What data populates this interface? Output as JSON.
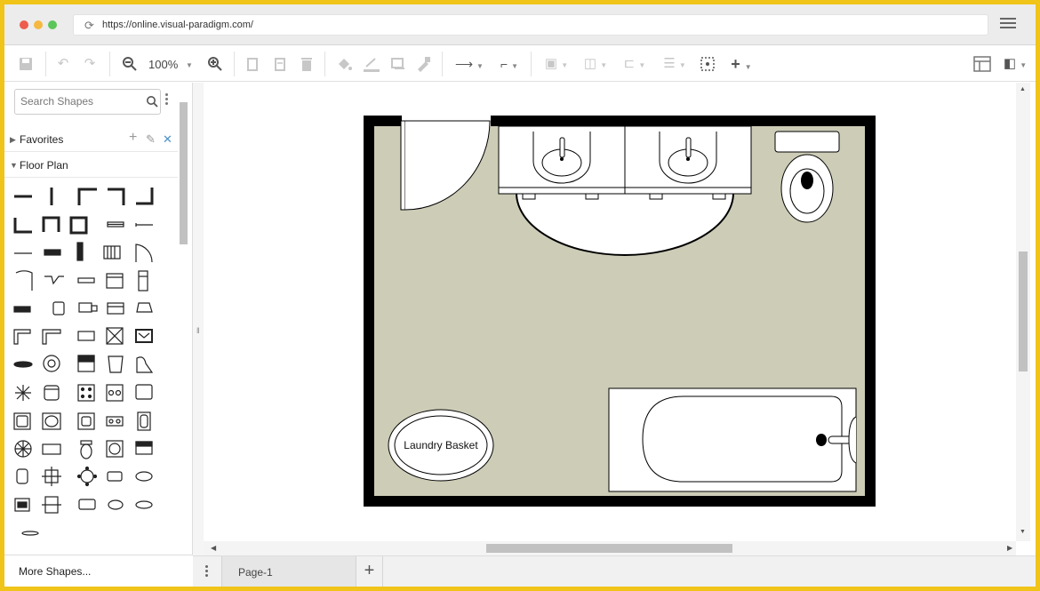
{
  "browser": {
    "url": "https://online.visual-paradigm.com/",
    "dots": [
      "#ee5c4d",
      "#f5b941",
      "#5bc55a"
    ]
  },
  "toolbar": {
    "zoom_value": "100%"
  },
  "sidebar": {
    "search_placeholder": "Search Shapes",
    "sections": [
      {
        "label": "Favorites",
        "expanded": false
      },
      {
        "label": "Floor Plan",
        "expanded": true
      }
    ],
    "more_shapes_label": "More Shapes..."
  },
  "canvas": {
    "floor_color": "#cdccb7",
    "wall_color": "#000000",
    "laundry_basket_label": "Laundry Basket"
  },
  "pages": {
    "tabs": [
      "Page-1"
    ],
    "add_label": "+"
  }
}
